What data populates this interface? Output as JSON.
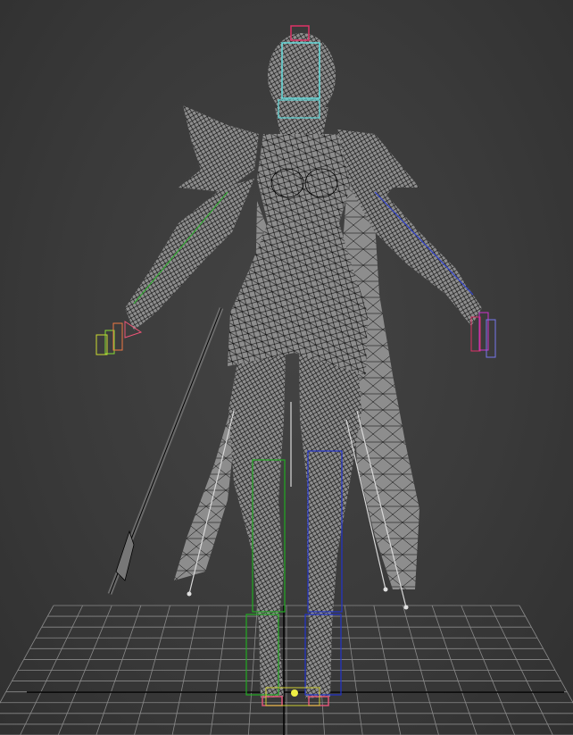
{
  "viewport": {
    "background": "#3b3b3b",
    "grid_color": "#8a8a8a",
    "axis_color": "#000000"
  },
  "model": {
    "mesh_fill": "#8d8d8d",
    "wire_color": "#000000",
    "bone_colors": {
      "left_leg": "#22aa22",
      "right_leg": "#2233cc",
      "head": "#66dddd",
      "head_top": "#dd3366",
      "left_hand": "#ccdd33",
      "right_hand": "#cc33cc",
      "left_arm": "#33aa33",
      "right_arm": "#3344cc",
      "feet": "#dd5577",
      "cape_bones": "#d8d8d8"
    }
  },
  "icons": {
    "grid": "viewport-grid-icon",
    "model": "character-wireframe-icon"
  }
}
